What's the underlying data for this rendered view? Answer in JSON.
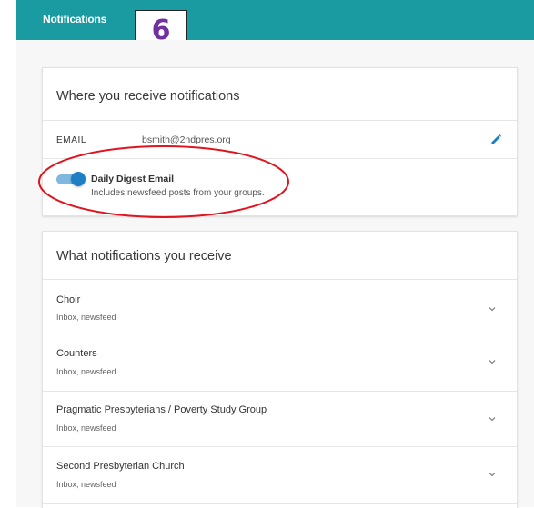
{
  "header": {
    "title": "Notifications",
    "step_number": "6"
  },
  "receive_card": {
    "title": "Where you receive notifications",
    "email_label": "EMAIL",
    "email_value": "bsmith@2ndpres.org",
    "digest_title": "Daily Digest Email",
    "digest_subtitle": "Includes newsfeed posts from your groups.",
    "digest_enabled": true
  },
  "what_card": {
    "title": "What notifications you receive",
    "groups": [
      {
        "name": "Choir",
        "channels": "Inbox, newsfeed"
      },
      {
        "name": "Counters",
        "channels": "Inbox, newsfeed"
      },
      {
        "name": "Pragmatic Presbyterians / Poverty Study Group",
        "channels": "Inbox, newsfeed"
      },
      {
        "name": "Second Presbyterian Church",
        "channels": "Inbox, newsfeed"
      }
    ]
  },
  "colors": {
    "header": "#1a9aa1",
    "toggle": "#1f7fc4",
    "annotation": "#e0141e",
    "badge_text": "#7030a0"
  }
}
